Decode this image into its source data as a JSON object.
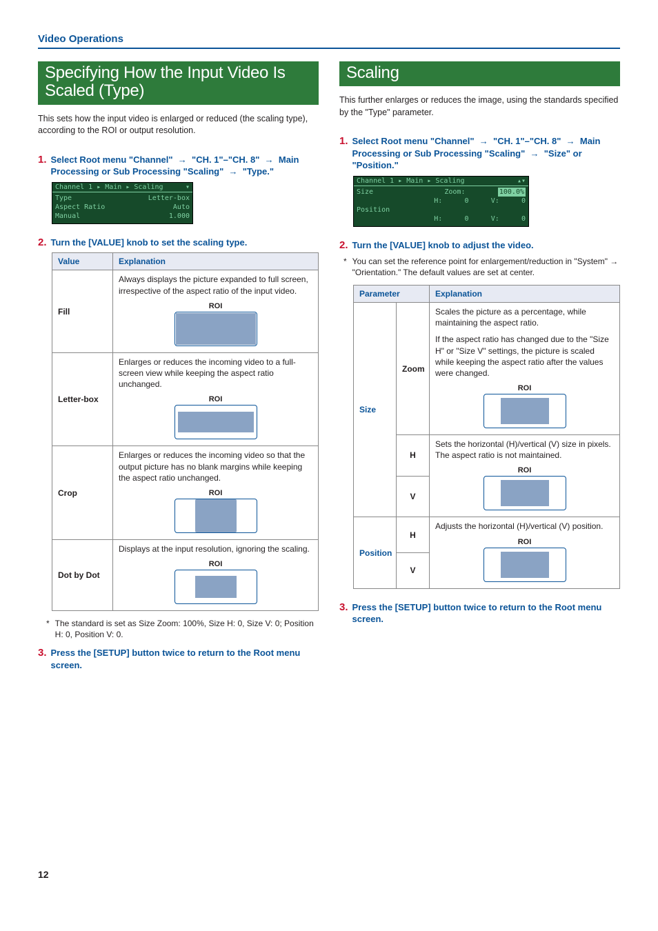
{
  "header": "Video Operations",
  "pageNumber": "12",
  "left": {
    "title": "Specifying How the Input Video Is Scaled (Type)",
    "intro": "This sets how the input video is enlarged or reduced (the scaling type), according to the ROI or output resolution.",
    "steps": {
      "s1": {
        "num": "1.",
        "a": "Select Root menu \"Channel\"",
        "b": "\"CH. 1\"–\"CH. 8\"",
        "c": "Main Processing or Sub Processing \"Scaling\"",
        "d": "\"Type.\""
      },
      "s2": {
        "num": "2.",
        "text": "Turn the [VALUE] knob to set the scaling type."
      },
      "s3": {
        "num": "3.",
        "text": "Press the [SETUP] button twice to return to the Root menu screen."
      }
    },
    "display": {
      "breadcrumb": "Channel 1 ▸ Main ▸ Scaling",
      "lines": [
        {
          "l": "Type",
          "r": "Letter-box"
        },
        {
          "l": "Aspect Ratio",
          "r": "Auto"
        },
        {
          "l": "Manual",
          "r": "1.000"
        }
      ]
    },
    "table": {
      "h1": "Value",
      "h2": "Explanation",
      "rows": [
        {
          "v": "Fill",
          "e": "Always displays the picture expanded to full screen, irrespective of the aspect ratio of the input video.",
          "roi": "ROI"
        },
        {
          "v": "Letter-box",
          "e": "Enlarges or reduces the incoming video to a full-screen view while keeping the aspect ratio unchanged.",
          "roi": "ROI"
        },
        {
          "v": "Crop",
          "e": "Enlarges or reduces the incoming video so that the output picture has no blank margins while keeping the aspect ratio unchanged.",
          "roi": "ROI"
        },
        {
          "v": "Dot by Dot",
          "e": "Displays at the input resolution, ignoring the scaling.",
          "roi": "ROI"
        }
      ]
    },
    "footnote": "The standard is set as Size Zoom: 100%, Size H: 0, Size V: 0; Position H: 0, Position V: 0."
  },
  "right": {
    "title": "Scaling",
    "intro": "This further enlarges or reduces the image, using the standards specified by the \"Type\" parameter.",
    "steps": {
      "s1": {
        "num": "1.",
        "a": "Select Root menu \"Channel\"",
        "b": "\"CH. 1\"–\"CH. 8\"",
        "c": "Main Processing or Sub Processing \"Scaling\"",
        "d": "\"Size\" or \"Position.\""
      },
      "s2": {
        "num": "2.",
        "text": "Turn the [VALUE] knob to adjust the video."
      },
      "s3": {
        "num": "3.",
        "text": "Press the [SETUP] button twice to return to the Root menu screen."
      }
    },
    "display": {
      "breadcrumb": "Channel 1 ▸ Main ▸ Scaling",
      "l1": {
        "l": "Size",
        "m": "Zoom:",
        "r": "100.0%"
      },
      "l2": {
        "l": "",
        "m": "H:",
        "r1": "0",
        "m2": "V:",
        "r2": "0"
      },
      "l3": {
        "l": "Position"
      },
      "l4": {
        "m": "H:",
        "r1": "0",
        "m2": "V:",
        "r2": "0"
      }
    },
    "footnote": "You can set the reference point for enlargement/reduction in \"System\" → \"Orientation.\" The default values are set at center.",
    "table": {
      "h1": "Parameter",
      "h2": "Explanation",
      "size": {
        "label": "Size",
        "zoom": {
          "label": "Zoom",
          "e1": "Scales the picture as a percentage, while maintaining the aspect ratio.",
          "e2": "If the aspect ratio has changed due to the \"Size H\" or \"Size V\" settings, the picture is scaled while keeping the aspect ratio after the values were changed.",
          "roi": "ROI"
        },
        "h": {
          "label": "H",
          "e": "Sets the horizontal (H)/vertical (V) size in pixels. The aspect ratio is not maintained.",
          "roi": "ROI"
        },
        "v": {
          "label": "V"
        }
      },
      "position": {
        "label": "Position",
        "h": {
          "label": "H",
          "e": "Adjusts the horizontal (H)/vertical (V) position.",
          "roi": "ROI"
        },
        "v": {
          "label": "V"
        }
      }
    }
  }
}
